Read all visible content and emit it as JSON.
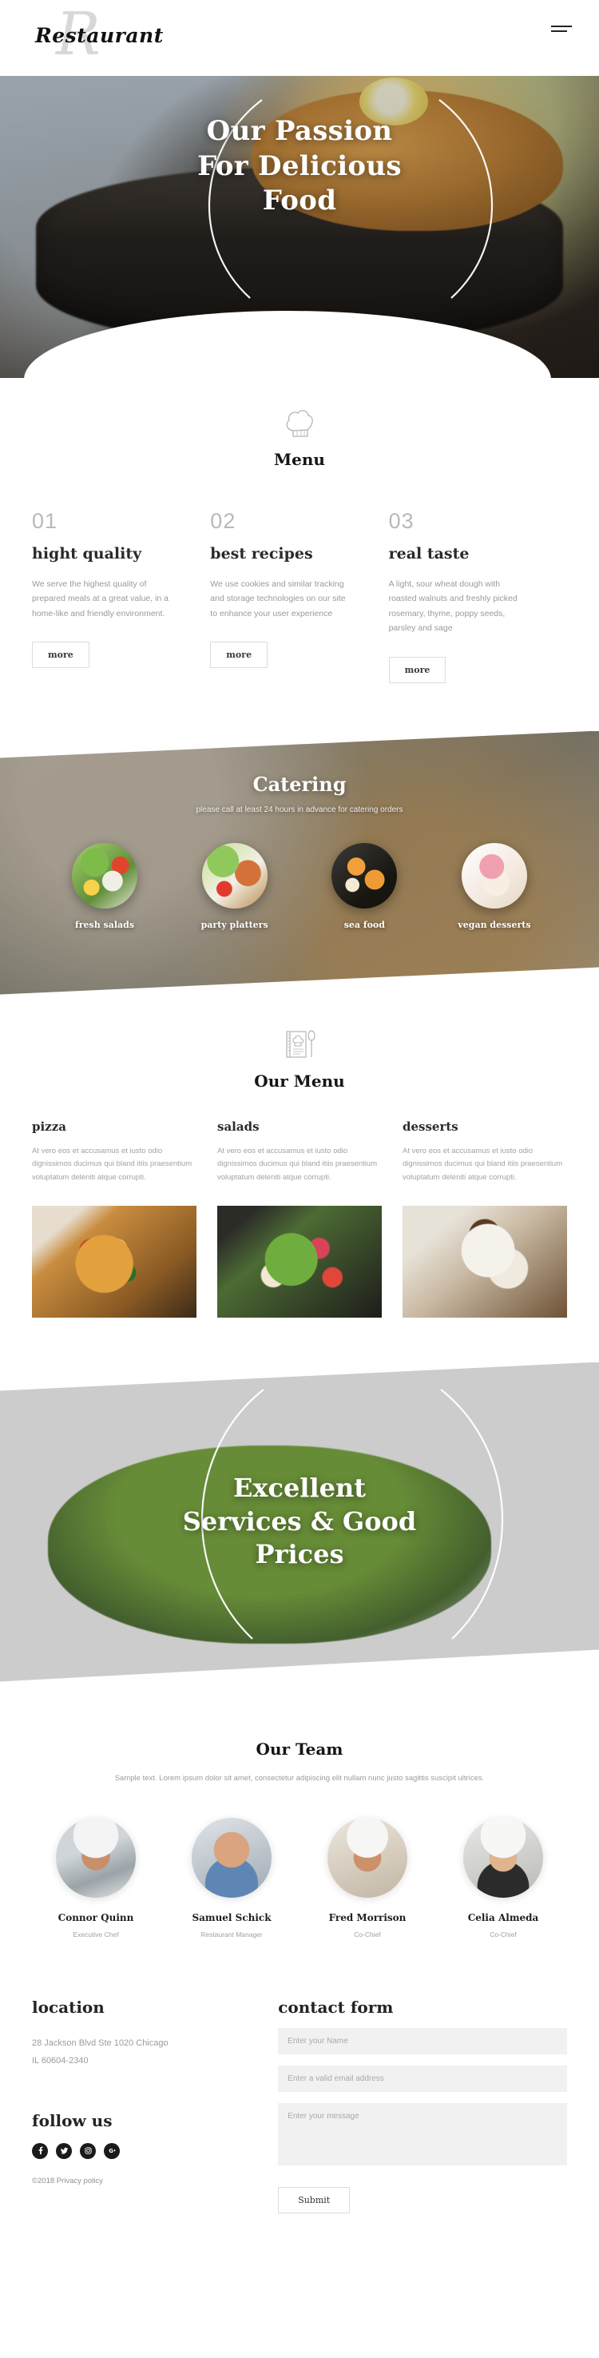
{
  "header": {
    "logo_text": "Restaurant",
    "logo_mark": "R",
    "menu_icon": "hamburger-menu-icon"
  },
  "hero": {
    "title_line1": "Our Passion",
    "title_line2": "For Delicious",
    "title_line3": "Food"
  },
  "menu_intro": {
    "icon": "chef-hat-icon",
    "heading": "Menu",
    "features": [
      {
        "number": "01",
        "title": "hight quality",
        "text": "We serve the highest quality of prepared meals at a great value, in a home-like and friendly environment.",
        "button": "more"
      },
      {
        "number": "02",
        "title": "best recipes",
        "text": "We use cookies and similar tracking and storage technologies on our site to enhance your user experience",
        "button": "more"
      },
      {
        "number": "03",
        "title": "real taste",
        "text": "A light, sour wheat dough with roasted walnuts and freshly picked rosemary, thyme, poppy seeds, parsley and sage",
        "button": "more"
      }
    ]
  },
  "catering": {
    "title": "Catering",
    "subtitle": "please call at least 24 hours in advance for catering orders",
    "items": [
      {
        "label": "fresh salads",
        "image": "salad-photo"
      },
      {
        "label": "party platters",
        "image": "platter-photo"
      },
      {
        "label": "sea food",
        "image": "sushi-photo"
      },
      {
        "label": "vegan desserts",
        "image": "dessert-photo"
      }
    ]
  },
  "our_menu": {
    "icon": "menu-book-icon",
    "heading": "Our Menu",
    "cards": [
      {
        "title": "pizza",
        "text": "At vero eos et accusamus et iusto odio dignissimos ducimus qui bland itiis praesentium voluptatum deleniti atque corrupti.",
        "image": "pizza-photo"
      },
      {
        "title": "salads",
        "text": "At vero eos et accusamus et iusto odio dignissimos ducimus qui bland itiis praesentium voluptatum deleniti atque corrupti.",
        "image": "salad-bowl-photo"
      },
      {
        "title": "desserts",
        "text": "At vero eos et accusamus et iusto odio dignissimos ducimus qui bland itiis praesentium voluptatum deleniti atque corrupti.",
        "image": "dessert-mug-photo"
      }
    ]
  },
  "banner2": {
    "title_line1": "Excellent",
    "title_line2": "Services & Good",
    "title_line3": "Prices"
  },
  "team": {
    "heading": "Our Team",
    "subtitle": "Sample text. Lorem ipsum dolor sit amet, consectetur adipiscing elit nullam nunc justo sagittis suscipit ultrices.",
    "members": [
      {
        "name": "Connor Quinn",
        "role": "Executive Chef",
        "photo": "chef-portrait"
      },
      {
        "name": "Samuel Schick",
        "role": "Restaurant Manager",
        "photo": "manager-portrait"
      },
      {
        "name": "Fred Morrison",
        "role": "Co-Chief",
        "photo": "cochief-portrait"
      },
      {
        "name": "Celia Almeda",
        "role": "Co-Chief",
        "photo": "cochief2-portrait"
      }
    ]
  },
  "footer": {
    "location_heading": "location",
    "address_line1": "28 Jackson Blvd Ste 1020 Chicago",
    "address_line2": "IL 60604-2340",
    "follow_heading": "follow us",
    "socials": [
      {
        "name": "facebook-icon",
        "glyph": "f"
      },
      {
        "name": "twitter-icon",
        "glyph": "ᵛ"
      },
      {
        "name": "instagram-icon",
        "glyph": "□"
      },
      {
        "name": "google-plus-icon",
        "glyph": "G"
      }
    ],
    "copyright": "©2018 Privacy policy",
    "contact_heading": "contact form",
    "name_placeholder": "Enter your Name",
    "email_placeholder": "Enter a valid email address",
    "message_placeholder": "Enter your message",
    "submit_label": "Submit"
  },
  "colors": {
    "text_dark": "#1e1e1e",
    "text_muted": "#9b9b9b",
    "field_bg": "#f1f1f1",
    "border": "#dcdcdc"
  }
}
